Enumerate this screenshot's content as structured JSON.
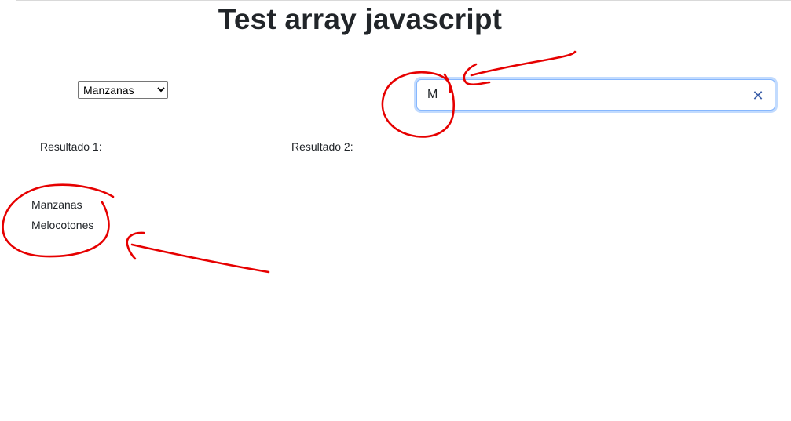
{
  "page": {
    "title": "Test array javascript"
  },
  "filter": {
    "selected_option": "Manzanas",
    "options": [
      "Manzanas"
    ]
  },
  "search": {
    "value": "M",
    "clear_icon": "close-icon"
  },
  "results": {
    "result1_label": "Resultado 1:",
    "result2_label": "Resultado 2:",
    "result1_items": [
      "Manzanas",
      "Melocotones"
    ]
  },
  "colors": {
    "annotation": "#e60000",
    "focus_border": "#86b7fe",
    "clear_icon": "#3b5ea8"
  }
}
